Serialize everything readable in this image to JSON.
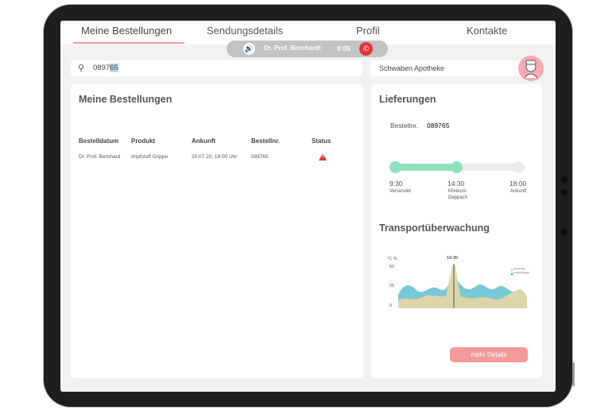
{
  "nav": {
    "tabs": [
      "Meine Bestellungen",
      "Sendungsdetails",
      "Profil",
      "Kontakte"
    ],
    "active": "Meine Bestellungen"
  },
  "call": {
    "name": "Dr. Prof. Bernhardt",
    "duration": "0:05"
  },
  "search": {
    "value_plain": "0897",
    "value_selected": "65"
  },
  "pharmacy": "Schwaben Apotheke",
  "orders": {
    "title": "Meine Bestellungen",
    "columns": [
      "Bestelldatum",
      "Produkt",
      "Ankunft",
      "Bestellnr.",
      "Status"
    ],
    "rows": [
      {
        "bestelldatum": "Dr. Prof. Bernhard",
        "produkt": "Impfstoff Grippe",
        "ankunft": "20.07.20, 18:00 Uhr",
        "bestellnr": "089765",
        "status": "warning"
      }
    ]
  },
  "deliveries": {
    "title": "Lieferungen",
    "order_label": "Bestellnr.",
    "order_no": "089765",
    "steps": [
      {
        "time": "9:30",
        "label": "Versendet",
        "sublabel": ""
      },
      {
        "time": "14:30",
        "label": "Klinikum",
        "sublabel": "Deppach"
      },
      {
        "time": "18:00",
        "label": "Ankunft",
        "sublabel": ""
      }
    ],
    "progress_fraction": 0.5
  },
  "transport": {
    "title": "Transportüberwachung",
    "unit_labels": "°C  %",
    "marker_time": "14:30",
    "y_ticks": [
      "50",
      "25",
      "0"
    ],
    "legend": [
      "Temperatur",
      "Luftfeuchtigkeit"
    ],
    "details_button": "mehr Details"
  },
  "colors": {
    "accent": "#f49a9a",
    "progress": "#8de2bc",
    "warning": "#e33d3d",
    "area1": "#5fc0cf",
    "area2": "#e5d6a4"
  }
}
